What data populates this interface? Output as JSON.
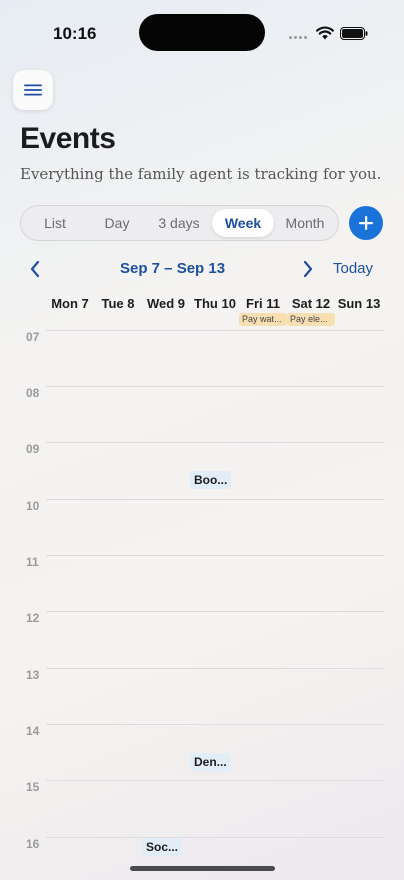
{
  "status_bar": {
    "time": "10:16"
  },
  "header": {
    "title": "Events",
    "subtitle": "Everything the family agent is tracking for you."
  },
  "view_switcher": {
    "options": [
      "List",
      "Day",
      "3 days",
      "Week",
      "Month"
    ],
    "selected": "Week"
  },
  "calendar_nav": {
    "range": "Sep 7 – Sep 13",
    "today_label": "Today"
  },
  "days": [
    "Mon 7",
    "Tue 8",
    "Wed 9",
    "Thu 10",
    "Fri 11",
    "Sat 12",
    "Sun 13"
  ],
  "all_day_events": [
    {
      "label": "Pay wat...",
      "day": "Fri 11",
      "color": "#f7dfb1"
    },
    {
      "label": "Pay ele...",
      "day": "Sat 12",
      "color": "#f7dfb1"
    }
  ],
  "hours": [
    "07",
    "08",
    "09",
    "10",
    "11",
    "12",
    "13",
    "14",
    "15",
    "16"
  ],
  "events": [
    {
      "label": "Boo...",
      "day": "Thu 10",
      "start_hour": 9.65
    },
    {
      "label": "Den...",
      "day": "Thu 10",
      "start_hour": 14.65
    },
    {
      "label": "Soc...",
      "day": "Wed 9",
      "start_hour": 16.15
    }
  ],
  "colors": {
    "accent": "#1e4fa0",
    "add_button": "#1a73d9",
    "event_bg": "#e3edf7"
  }
}
